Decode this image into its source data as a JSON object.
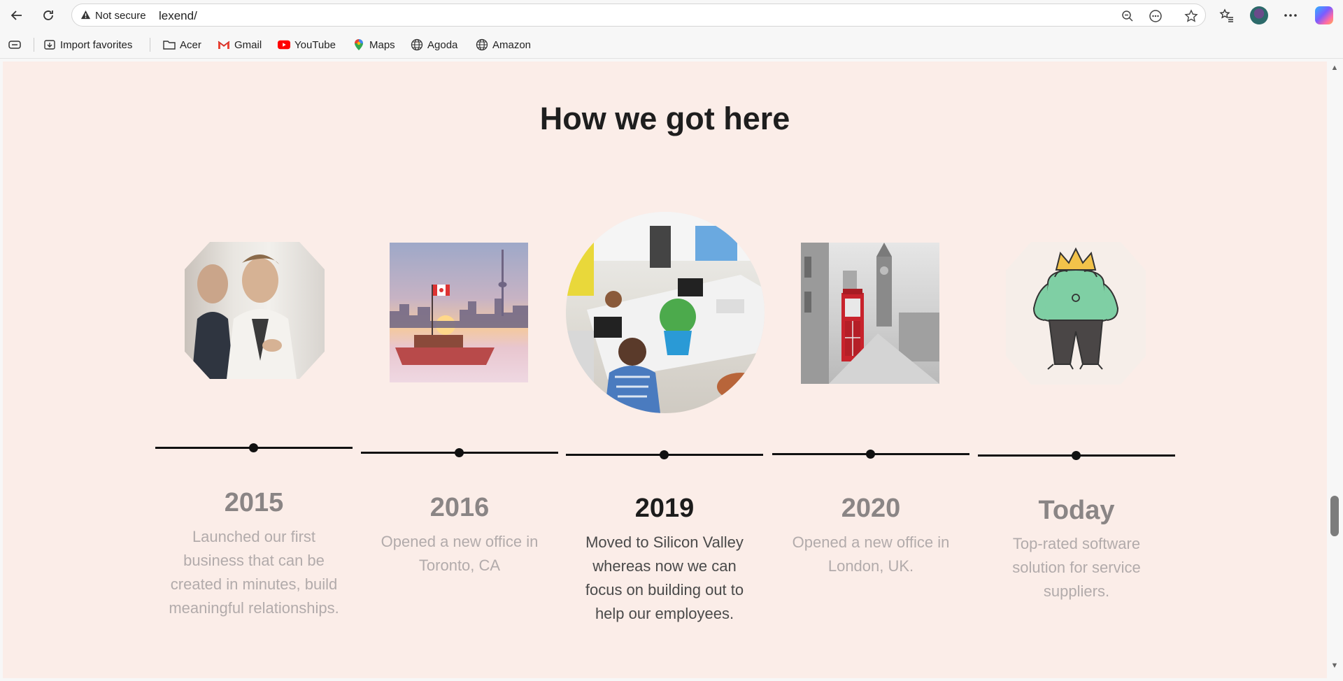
{
  "browser": {
    "security_label": "Not secure",
    "url": "lexend/"
  },
  "favorites": [
    {
      "label": "Import favorites",
      "icon": "import-icon"
    },
    {
      "label": "Acer",
      "icon": "folder-icon"
    },
    {
      "label": "Gmail",
      "icon": "gmail-icon"
    },
    {
      "label": "YouTube",
      "icon": "youtube-icon"
    },
    {
      "label": "Maps",
      "icon": "maps-pin-icon"
    },
    {
      "label": "Agoda",
      "icon": "globe-icon"
    },
    {
      "label": "Amazon",
      "icon": "globe-icon"
    }
  ],
  "page": {
    "title": "How we got here",
    "timeline": [
      {
        "year": "2015",
        "description": "Launched our first business that can be created in minutes, build meaningful relationships.",
        "image": "two-men-talking-photo",
        "active": false
      },
      {
        "year": "2016",
        "description": "Opened a new office in Toronto, CA",
        "image": "toronto-skyline-photo",
        "active": false
      },
      {
        "year": "2019",
        "description": "Moved to Silicon Valley whereas now we can focus on building out to help our employees.",
        "image": "open-office-photo",
        "active": true
      },
      {
        "year": "2020",
        "description": "Opened a new office in London, UK.",
        "image": "london-phone-box-photo",
        "active": false
      },
      {
        "year": "Today",
        "description": "Top-rated software solution for service suppliers.",
        "image": "crowned-character-illustration",
        "active": false
      }
    ]
  },
  "colors": {
    "page_background": "#fbede8",
    "heading": "#1e1e1e",
    "muted_year": "#8a8585",
    "muted_text": "#b2abab"
  }
}
